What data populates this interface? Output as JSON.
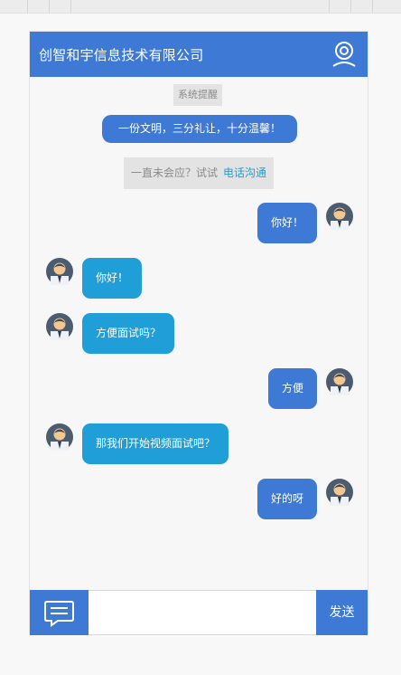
{
  "header": {
    "title": "创智和宇信息技术有限公司"
  },
  "system": {
    "reminder": "系统提醒",
    "notice": "一份文明，三分礼让，十分温馨！",
    "call_prompt": "一直未会应？试试",
    "call_link": "电话沟通"
  },
  "messages": [
    {
      "side": "right",
      "text": "你好！"
    },
    {
      "side": "left",
      "text": "你好！"
    },
    {
      "side": "left",
      "text": "方便面试吗？"
    },
    {
      "side": "right",
      "text": "方便"
    },
    {
      "side": "left",
      "text": "那我们开始视频面试吧？"
    },
    {
      "side": "right",
      "text": "好的呀"
    }
  ],
  "footer": {
    "input_value": "",
    "send_label": "发送"
  },
  "colors": {
    "primary": "#3e79d5",
    "left_bubble": "#1f9ed8",
    "link": "#1aa0d7"
  }
}
